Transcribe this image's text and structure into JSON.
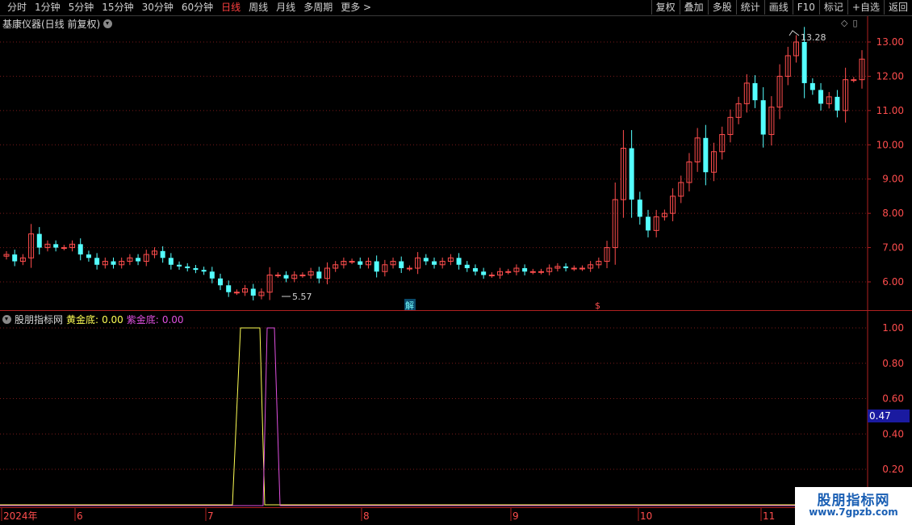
{
  "toolbar": {
    "periods": [
      "分时",
      "1分钟",
      "5分钟",
      "15分钟",
      "30分钟",
      "60分钟",
      "日线",
      "周线",
      "月线",
      "多周期",
      "更多 >"
    ],
    "active_period": "日线",
    "buttons": [
      "复权",
      "叠加",
      "多股",
      "统计",
      "画线",
      "F10",
      "标记",
      "+自选",
      "返回"
    ]
  },
  "main_panel": {
    "title": "基康仪器(日线 前复权)",
    "high_label": "13.28",
    "low_label": "5.57",
    "event_marker_1": "解",
    "event_marker_2": "$",
    "y_axis_labels": [
      "13.00",
      "12.00",
      "11.00",
      "10.00",
      "9.00",
      "8.00",
      "7.00",
      "6.00"
    ]
  },
  "indicator_panel": {
    "name": "股朋指标网",
    "gold_label": "黄金底:",
    "gold_value": "0.00",
    "purple_label": "紫金底:",
    "purple_value": "0.00",
    "y_axis_labels": [
      "1.00",
      "0.80",
      "0.60",
      "0.40",
      "0.20"
    ],
    "current_value_tag": "0.47"
  },
  "time_axis": {
    "labels": [
      "2024年",
      "6",
      "7",
      "8",
      "9",
      "10",
      "11"
    ]
  },
  "colors": {
    "up": "#ff4d4d",
    "down": "#54ffff",
    "gold_line": "#ffff55",
    "purple_line": "#e050e0",
    "grid": "#7a1a1a",
    "frame": "#b02020"
  },
  "chart_data": {
    "type": "candlestick",
    "closes": [
      6.8,
      6.6,
      6.7,
      7.4,
      7.0,
      7.1,
      7.0,
      7.0,
      7.1,
      6.8,
      6.7,
      6.5,
      6.6,
      6.5,
      6.6,
      6.7,
      6.6,
      6.8,
      6.9,
      6.7,
      6.5,
      6.45,
      6.4,
      6.35,
      6.3,
      6.1,
      5.9,
      5.7,
      5.7,
      5.8,
      5.6,
      5.7,
      6.2,
      6.2,
      6.1,
      6.2,
      6.2,
      6.3,
      6.1,
      6.4,
      6.5,
      6.6,
      6.6,
      6.5,
      6.6,
      6.3,
      6.5,
      6.6,
      6.4,
      6.4,
      6.7,
      6.6,
      6.5,
      6.6,
      6.7,
      6.5,
      6.4,
      6.3,
      6.2,
      6.2,
      6.3,
      6.3,
      6.4,
      6.3,
      6.3,
      6.3,
      6.4,
      6.45,
      6.4,
      6.4,
      6.4,
      6.5,
      6.6,
      7.0,
      8.4,
      9.9,
      8.4,
      7.9,
      7.5,
      7.9,
      8.0,
      8.5,
      8.9,
      9.5,
      10.2,
      9.2,
      9.8,
      10.3,
      10.8,
      11.2,
      11.8,
      11.3,
      10.3,
      11.1,
      12.0,
      12.6,
      13.0,
      11.8,
      11.6,
      11.2,
      11.4,
      11.0,
      11.9,
      11.9,
      12.5
    ],
    "high": "13.28",
    "low": "5.57",
    "ylim": [
      5.3,
      13.5
    ]
  }
}
